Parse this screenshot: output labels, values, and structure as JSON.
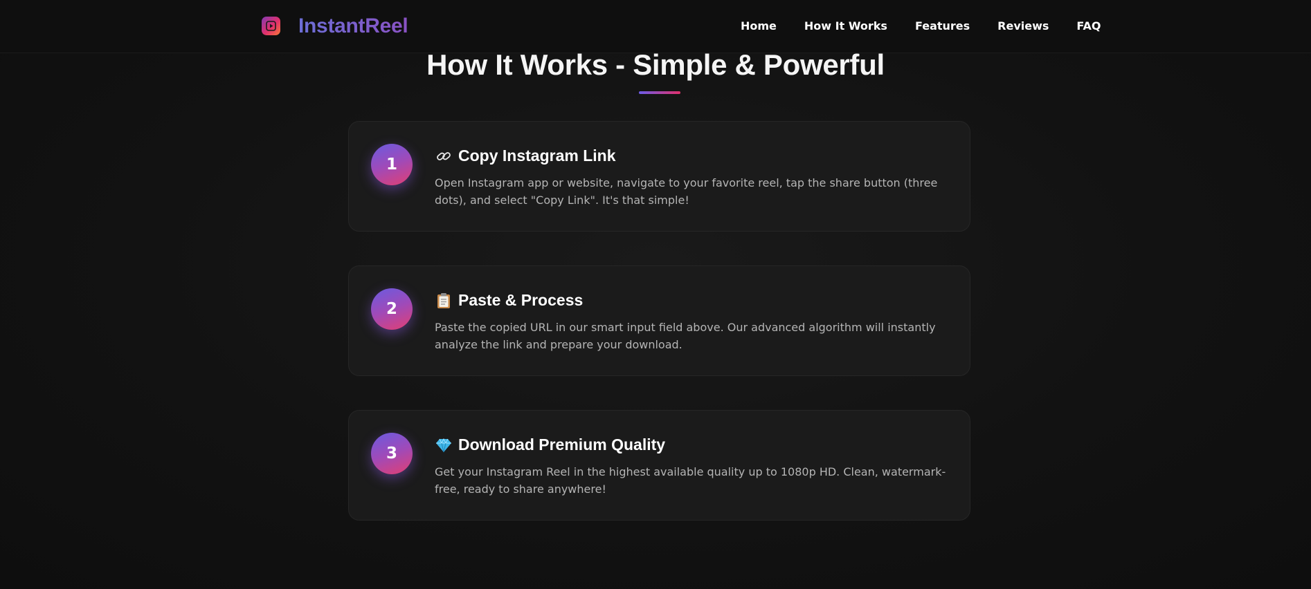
{
  "navbar": {
    "brand": "InstantReel",
    "links": [
      "Home",
      "How It Works",
      "Features",
      "Reviews",
      "FAQ"
    ]
  },
  "section": {
    "title": "How It Works - Simple & Powerful"
  },
  "steps": [
    {
      "number": "1",
      "icon": "link-icon",
      "title": "Copy Instagram Link",
      "description": "Open Instagram app or website, navigate to your favorite reel, tap the share button (three dots), and select \"Copy Link\". It's that simple!"
    },
    {
      "number": "2",
      "icon": "clipboard-icon",
      "title": "Paste & Process",
      "description": "Paste the copied URL in our smart input field above. Our advanced algorithm will instantly analyze the link and prepare your download."
    },
    {
      "number": "3",
      "icon": "gem-icon",
      "title": "Download Premium Quality",
      "description": "Get your Instagram Reel in the highest available quality up to 1080p HD. Clean, watermark-free, ready to share anywhere!"
    }
  ],
  "colors": {
    "accent_start": "#6c5ce7",
    "accent_end": "#e1306c",
    "background": "#121212",
    "card": "#1b1b1b"
  }
}
